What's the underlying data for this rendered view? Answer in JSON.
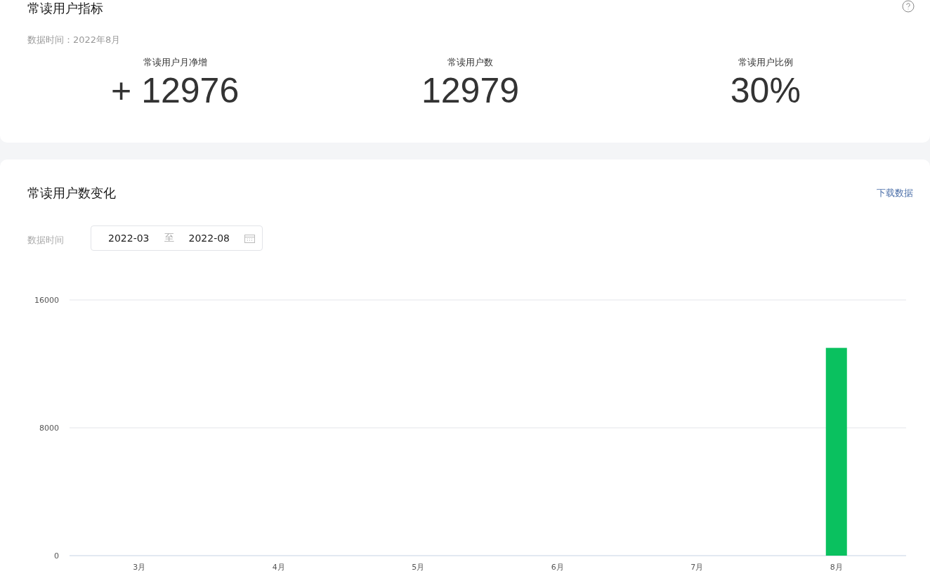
{
  "summary_card": {
    "title": "常读用户指标",
    "data_time": "数据时间：2022年8月",
    "metrics": [
      {
        "label": "常读用户月净增",
        "value": "+ 12976"
      },
      {
        "label": "常读用户数",
        "value": "12979"
      },
      {
        "label": "常读用户比例",
        "value": "30%"
      }
    ]
  },
  "trend_card": {
    "title": "常读用户数变化",
    "download_link": "下载数据",
    "filter_label": "数据时间",
    "date_range": {
      "start": "2022-03",
      "separator": "至",
      "end": "2022-08"
    },
    "chart_data": {
      "type": "bar",
      "categories": [
        "3月",
        "4月",
        "5月",
        "6月",
        "7月",
        "8月"
      ],
      "series": [
        {
          "color": "#0ac15f",
          "values": [
            0,
            0,
            0,
            0,
            0,
            13000
          ]
        }
      ],
      "ylim": [
        0,
        16000
      ],
      "yticks": [
        0,
        8000,
        16000
      ]
    }
  }
}
